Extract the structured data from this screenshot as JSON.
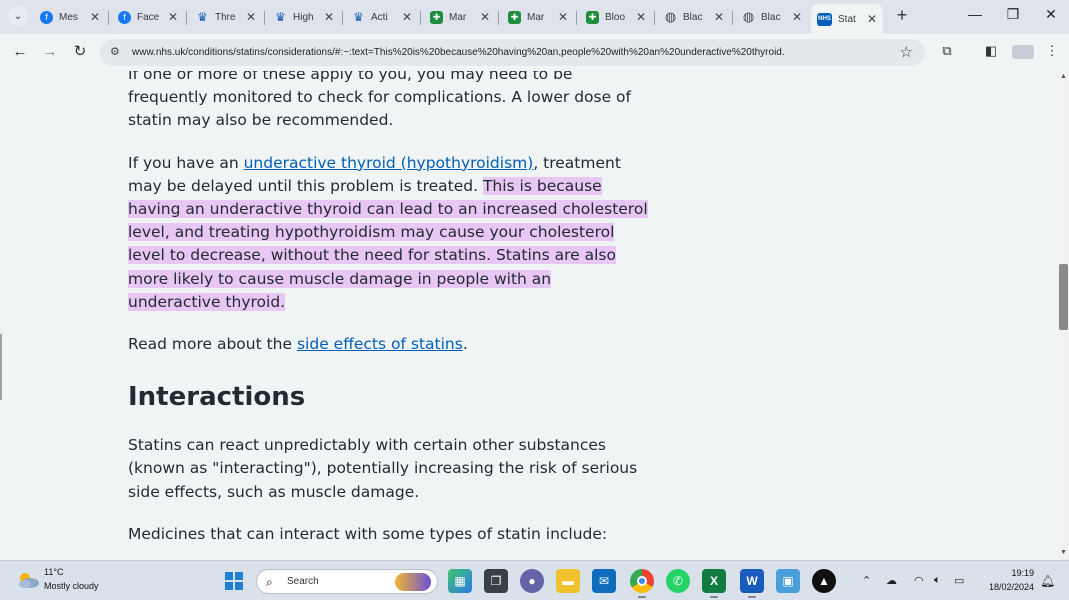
{
  "browser": {
    "tabs": [
      {
        "title": "Mes",
        "favicon": "facebook-icon",
        "color": "#1877f2"
      },
      {
        "title": "Face",
        "favicon": "facebook-icon",
        "color": "#1877f2"
      },
      {
        "title": "Thre",
        "favicon": "crown-icon",
        "color": "#1a5fb4"
      },
      {
        "title": "High",
        "favicon": "crown-icon",
        "color": "#1a5fb4"
      },
      {
        "title": "Acti",
        "favicon": "crown-icon",
        "color": "#1a5fb4"
      },
      {
        "title": "Mar",
        "favicon": "plus-icon",
        "color": "#1e8e3e"
      },
      {
        "title": "Mar",
        "favicon": "plus-icon",
        "color": "#1e8e3e"
      },
      {
        "title": "Bloo",
        "favicon": "plus-icon",
        "color": "#1e8e3e"
      },
      {
        "title": "Blac",
        "favicon": "globe-icon",
        "color": "#444444"
      },
      {
        "title": "Blac",
        "favicon": "globe-icon",
        "color": "#444444"
      },
      {
        "title": "Stat",
        "favicon": "nhs-icon",
        "color": "#005eb8",
        "active": true
      }
    ],
    "url": "www.nhs.uk/conditions/statins/considerations/#:~:text=This%20is%20because%20having%20an,people%20with%20an%20underactive%20thyroid."
  },
  "article": {
    "p1": "If one or more of these apply to you, you may need to be frequently monitored to check for complications. A lower dose of statin may also be recommended.",
    "p2_before": "If you have an ",
    "p2_link": "underactive thyroid (hypothyroidism)",
    "p2_mid": ", treatment may be delayed until this problem is treated. ",
    "p2_highlight": "This is because having an underactive thyroid can lead to an increased cholesterol level, and treating hypothyroidism may cause your cholesterol level to decrease, without the need for statins. Statins are also more likely to cause muscle damage in people with an underactive thyroid.",
    "p3_before": "Read more about the ",
    "p3_link": "side effects of statins",
    "p3_after": ".",
    "heading": "Interactions",
    "p4": "Statins can react unpredictably with certain other substances (known as \"interacting\"), potentially increasing the risk of serious side effects, such as muscle damage.",
    "p5": "Medicines that can interact with some types of statin include:",
    "highlight_color": "#e9c7f5",
    "link_color": "#005eb8"
  },
  "taskbar": {
    "weather_temp": "11°C",
    "weather_desc": "Mostly cloudy",
    "search_placeholder": "Search",
    "time": "19:19",
    "date": "18/02/2024"
  }
}
